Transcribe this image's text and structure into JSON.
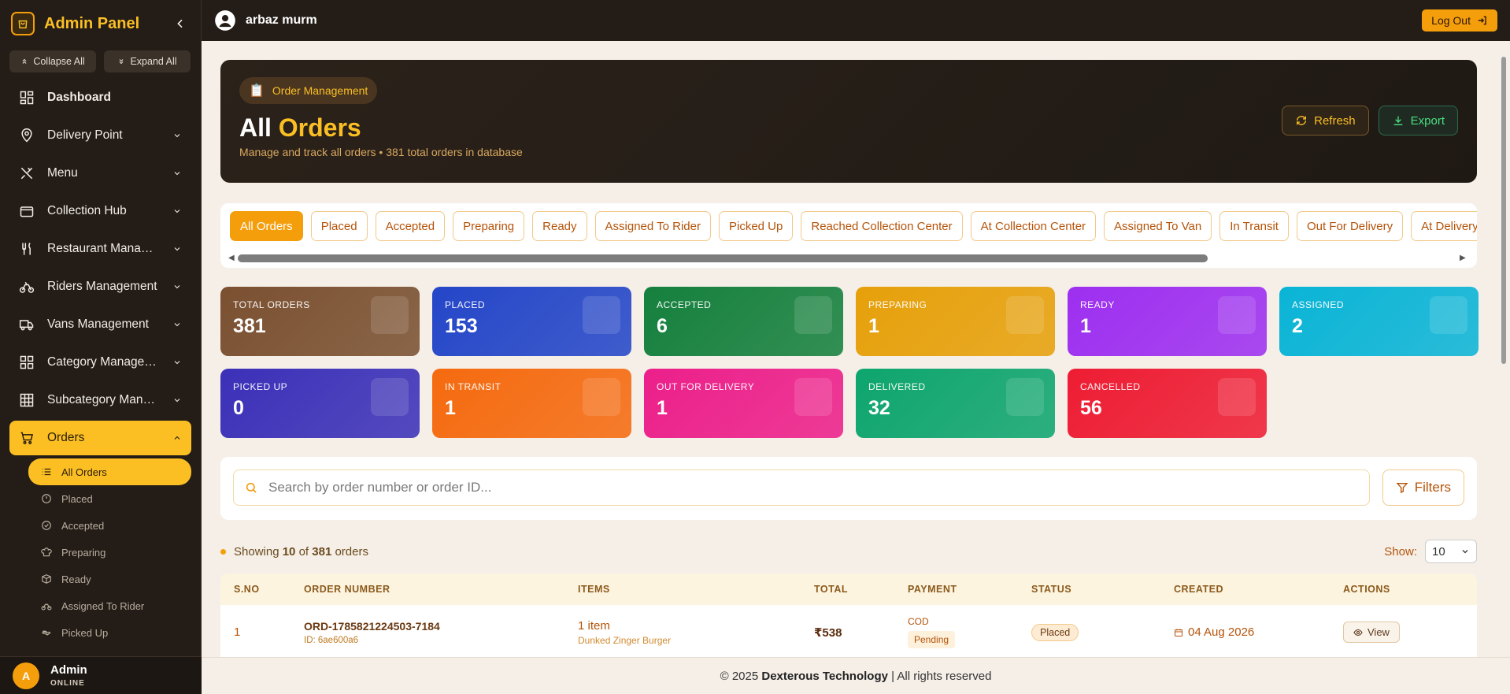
{
  "sidebar": {
    "title": "Admin Panel",
    "collapse_all": "Collapse All",
    "expand_all": "Expand All",
    "items": [
      {
        "label": "Dashboard",
        "icon": "grid-icon"
      },
      {
        "label": "Delivery Point",
        "icon": "map-pin-icon"
      },
      {
        "label": "Menu",
        "icon": "utensils-crossed-icon"
      },
      {
        "label": "Collection Hub",
        "icon": "box-icon"
      },
      {
        "label": "Restaurant Managem…",
        "icon": "fork-knife-icon"
      },
      {
        "label": "Riders Management",
        "icon": "bike-icon"
      },
      {
        "label": "Vans Management",
        "icon": "truck-icon"
      },
      {
        "label": "Category Management",
        "icon": "grid-icon"
      },
      {
        "label": "Subcategory Manage…",
        "icon": "table-icon"
      },
      {
        "label": "Orders",
        "icon": "cart-icon"
      }
    ],
    "sub_items": [
      {
        "label": "All Orders",
        "icon": "list-icon"
      },
      {
        "label": "Placed",
        "icon": "clock-icon"
      },
      {
        "label": "Accepted",
        "icon": "check-circle-icon"
      },
      {
        "label": "Preparing",
        "icon": "chef-hat-icon"
      },
      {
        "label": "Ready",
        "icon": "package-icon"
      },
      {
        "label": "Assigned To Rider",
        "icon": "bike-icon"
      },
      {
        "label": "Picked Up",
        "icon": "hand-icon"
      }
    ],
    "user": {
      "initial": "A",
      "name": "Admin",
      "status": "ONLINE"
    }
  },
  "topbar": {
    "username": "arbaz murm",
    "logout": "Log Out"
  },
  "hero": {
    "pill": "Order Management",
    "title_plain": "All",
    "title_accent": "Orders",
    "subtitle": "Manage and track all orders • 381 total orders in database",
    "refresh": "Refresh",
    "export": "Export"
  },
  "tabs": [
    "All Orders",
    "Placed",
    "Accepted",
    "Preparing",
    "Ready",
    "Assigned To Rider",
    "Picked Up",
    "Reached Collection Center",
    "At Collection Center",
    "Assigned To Van",
    "In Transit",
    "Out For Delivery",
    "At Delivery Point"
  ],
  "stats": [
    {
      "label": "TOTAL ORDERS",
      "value": "381",
      "color": "#7a5030"
    },
    {
      "label": "PLACED",
      "value": "153",
      "color": "#2446c8"
    },
    {
      "label": "ACCEPTED",
      "value": "6",
      "color": "#15803d"
    },
    {
      "label": "PREPARING",
      "value": "1",
      "color": "#e6a00a"
    },
    {
      "label": "READY",
      "value": "1",
      "color": "#9d2ff0"
    },
    {
      "label": "ASSIGNED",
      "value": "2",
      "color": "#0ab4d6"
    },
    {
      "label": "PICKED UP",
      "value": "0",
      "color": "#3b30b8"
    },
    {
      "label": "IN TRANSIT",
      "value": "1",
      "color": "#f56a0f"
    },
    {
      "label": "OUT FOR DELIVERY",
      "value": "1",
      "color": "#ec1f8a"
    },
    {
      "label": "DELIVERED",
      "value": "32",
      "color": "#0ea56e"
    },
    {
      "label": "CANCELLED",
      "value": "56",
      "color": "#ee1c33"
    }
  ],
  "search": {
    "placeholder": "Search by order number or order ID...",
    "filters": "Filters"
  },
  "listing": {
    "prefix": "Showing",
    "shown": "10",
    "of": "of",
    "total": "381",
    "suffix": "orders",
    "show_label": "Show:",
    "show_value": "10"
  },
  "table": {
    "headers": [
      "S.NO",
      "ORDER NUMBER",
      "ITEMS",
      "TOTAL",
      "PAYMENT",
      "STATUS",
      "CREATED",
      "ACTIONS"
    ],
    "rows": [
      {
        "sno": "1",
        "order_number": "ORD-1785821224503-7184",
        "order_id": "ID: 6ae600a6",
        "items_count": "1 item",
        "items_name": "Dunked Zinger Burger",
        "total": "₹538",
        "payment_method": "COD",
        "payment_status": "Pending",
        "status": "Placed",
        "created": "04 Aug 2026",
        "action": "View"
      }
    ]
  },
  "footer": {
    "prefix": "© 2025",
    "company": "Dexterous Technology",
    "suffix": "| All rights reserved"
  }
}
